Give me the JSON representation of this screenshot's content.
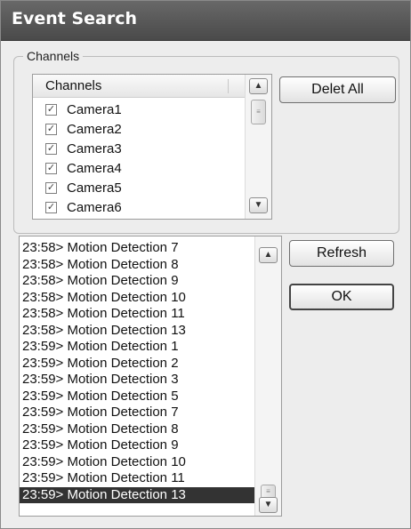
{
  "window": {
    "title": "Event Search"
  },
  "channels_group": {
    "legend": "Channels",
    "header": "Channels",
    "items": [
      {
        "label": "Camera1",
        "checked": true
      },
      {
        "label": "Camera2",
        "checked": true
      },
      {
        "label": "Camera3",
        "checked": true
      },
      {
        "label": "Camera4",
        "checked": true
      },
      {
        "label": "Camera5",
        "checked": true
      },
      {
        "label": "Camera6",
        "checked": true
      }
    ],
    "delete_all_label": "Delet All"
  },
  "events": {
    "items": [
      "23:58> Motion Detection 7",
      "23:58> Motion Detection 8",
      "23:58> Motion Detection 9",
      "23:58> Motion Detection 10",
      "23:58> Motion Detection 11",
      "23:58> Motion Detection 13",
      "23:59> Motion Detection 1",
      "23:59> Motion Detection 2",
      "23:59> Motion Detection 3",
      "23:59> Motion Detection 5",
      "23:59> Motion Detection 7",
      "23:59> Motion Detection 8",
      "23:59> Motion Detection 9",
      "23:59> Motion Detection 10",
      "23:59> Motion Detection 11",
      "23:59> Motion Detection 13"
    ],
    "selected_index": 15,
    "refresh_label": "Refresh",
    "ok_label": "OK"
  },
  "icons": {
    "checkbox_checked": "check-icon",
    "scroll_up": "chevron-up-icon",
    "scroll_down": "chevron-down-icon"
  },
  "colors": {
    "titlebar": "#555555",
    "selection": "#333333"
  }
}
